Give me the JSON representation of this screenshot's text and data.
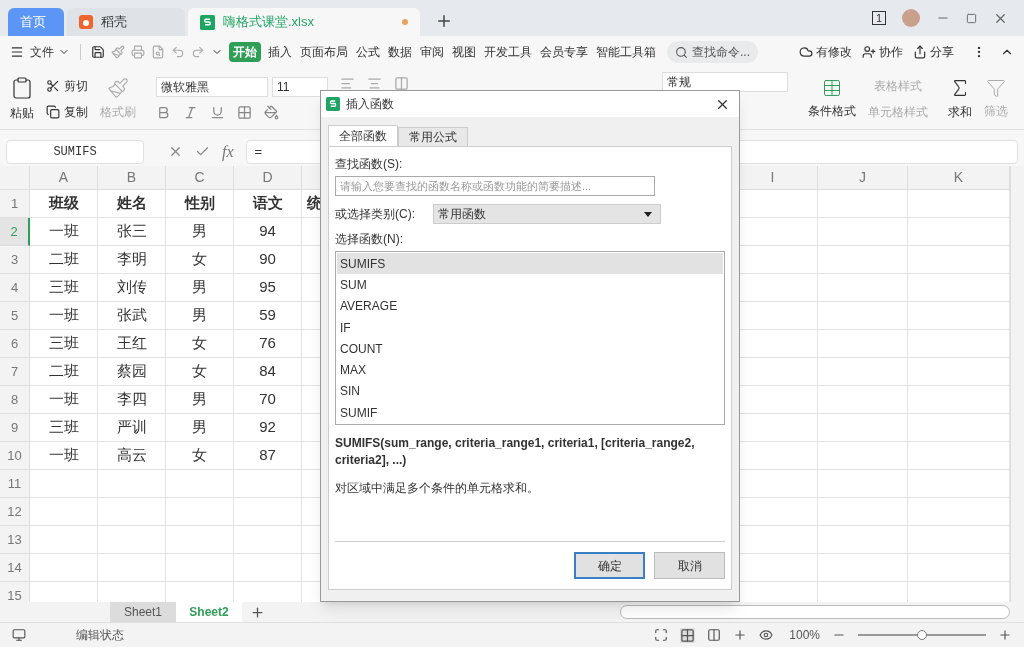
{
  "tabs": [
    {
      "label": "首页",
      "kind": "home",
      "selected": false
    },
    {
      "label": "稻壳",
      "kind": "docer",
      "selected": false
    },
    {
      "label": "嗨格式课堂.xlsx",
      "kind": "sheet",
      "selected": true
    }
  ],
  "window_badge": "1",
  "menu": {
    "file": "文件",
    "tabs": [
      {
        "label": "开始",
        "selected": true
      },
      {
        "label": "插入",
        "selected": false
      },
      {
        "label": "页面布局",
        "selected": false
      },
      {
        "label": "公式",
        "selected": false
      },
      {
        "label": "数据",
        "selected": false
      },
      {
        "label": "审阅",
        "selected": false
      },
      {
        "label": "视图",
        "selected": false
      },
      {
        "label": "开发工具",
        "selected": false
      },
      {
        "label": "会员专享",
        "selected": false
      },
      {
        "label": "智能工具箱",
        "selected": false
      }
    ],
    "search": {
      "placeholder": "查找命令..."
    },
    "actions": [
      {
        "label": "有修改",
        "kind": "cloud"
      },
      {
        "label": "协作",
        "kind": "user"
      },
      {
        "label": "分享",
        "kind": "share"
      }
    ]
  },
  "ribbon": {
    "paste": "粘贴",
    "cut": "剪切",
    "copy": "复制",
    "format_painter": "格式刷",
    "font": "微软雅黑",
    "size": "11",
    "number_format": "常规",
    "conditional_format": "条件格式",
    "table_style": "表格样式",
    "cell_style": "单元格样式",
    "sum": "求和",
    "filter": "筛选"
  },
  "formula_bar": {
    "name_box": "SUMIFS",
    "function_label": "fx",
    "formula": "="
  },
  "sheet": {
    "columns_left": [
      "A",
      "B",
      "C",
      "D"
    ],
    "columns_right": [
      "I",
      "J",
      "K"
    ],
    "rows": [
      {
        "number": "1",
        "selected": false,
        "cells": [
          "班级",
          "姓名",
          "性别",
          "语文",
          "统"
        ]
      },
      {
        "number": "2",
        "selected": true,
        "cells": [
          "一班",
          "张三",
          "男",
          "94"
        ]
      },
      {
        "number": "3",
        "selected": false,
        "cells": [
          "二班",
          "李明",
          "女",
          "90"
        ]
      },
      {
        "number": "4",
        "selected": false,
        "cells": [
          "三班",
          "刘传",
          "男",
          "95"
        ]
      },
      {
        "number": "5",
        "selected": false,
        "cells": [
          "一班",
          "张武",
          "男",
          "59"
        ]
      },
      {
        "number": "6",
        "selected": false,
        "cells": [
          "三班",
          "王红",
          "女",
          "76"
        ]
      },
      {
        "number": "7",
        "selected": false,
        "cells": [
          "二班",
          "蔡园",
          "女",
          "84"
        ]
      },
      {
        "number": "8",
        "selected": false,
        "cells": [
          "一班",
          "李四",
          "男",
          "70"
        ]
      },
      {
        "number": "9",
        "selected": false,
        "cells": [
          "三班",
          "严训",
          "男",
          "92"
        ]
      },
      {
        "number": "10",
        "selected": false,
        "cells": [
          "一班",
          "高云",
          "女",
          "87"
        ]
      },
      {
        "number": "11",
        "selected": false,
        "cells": []
      },
      {
        "number": "12",
        "selected": false,
        "cells": []
      },
      {
        "number": "13",
        "selected": false,
        "cells": []
      },
      {
        "number": "14",
        "selected": false,
        "cells": []
      },
      {
        "number": "15",
        "selected": false,
        "cells": []
      }
    ]
  },
  "dialog": {
    "title": "插入函数",
    "tabs": [
      {
        "label": "全部函数",
        "selected": true
      },
      {
        "label": "常用公式",
        "selected": false
      }
    ],
    "search_label": "查找函数(S):",
    "search_placeholder": "请输入您要查找的函数名称或函数功能的简要描述...",
    "category_label": "或选择类别(C):",
    "category": "常用函数",
    "list_label": "选择函数(N):",
    "functions": [
      {
        "name": "SUMIFS",
        "selected": true
      },
      {
        "name": "SUM",
        "selected": false
      },
      {
        "name": "AVERAGE",
        "selected": false
      },
      {
        "name": "IF",
        "selected": false
      },
      {
        "name": "COUNT",
        "selected": false
      },
      {
        "name": "MAX",
        "selected": false
      },
      {
        "name": "SIN",
        "selected": false
      },
      {
        "name": "SUMIF",
        "selected": false
      }
    ],
    "signature": "SUMIFS(sum_range, criteria_range1, criteria1, [criteria_range2, criteria2], ...)",
    "description": "对区域中满足多个条件的单元格求和。",
    "buttons": [
      {
        "label": "确定",
        "kind": "primary"
      },
      {
        "label": "取消",
        "kind": "secondary"
      }
    ]
  },
  "sheet_tabs": [
    {
      "label": "Sheet1",
      "selected": false
    },
    {
      "label": "Sheet2",
      "selected": true
    }
  ],
  "status": {
    "mode": "编辑状态",
    "zoom": "100%",
    "zoom_slider": {
      "level": 0.5
    }
  }
}
